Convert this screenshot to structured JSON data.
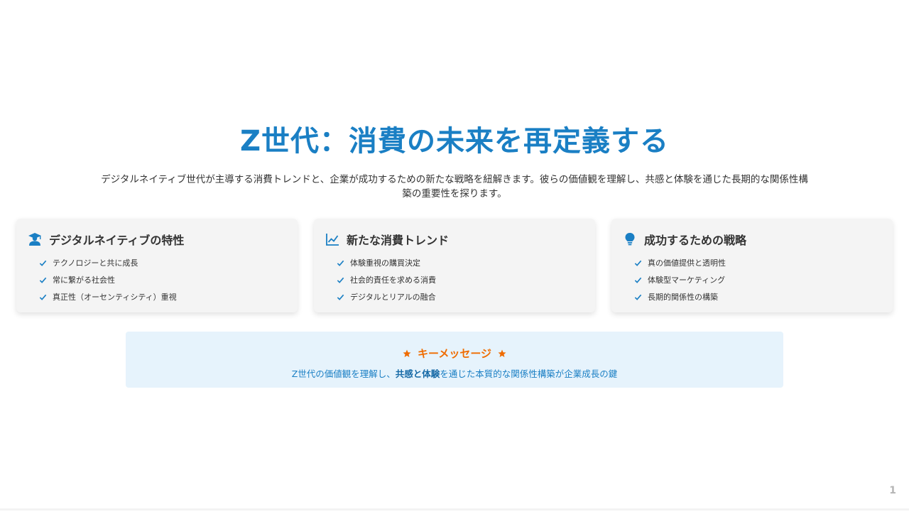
{
  "title": "Z世代：消費の未来を再定義する",
  "subtitle": "デジタルネイティブ世代が主導する消費トレンドと、企業が成功するための新たな戦略を紐解きます。彼らの価値観を理解し、共感と体験を通じた長期的な関係性構築の重要性を探ります。",
  "cards": [
    {
      "icon": "graduate-icon",
      "title": "デジタルネイティブの特性",
      "items": [
        "テクノロジーと共に成長",
        "常に繋がる社会性",
        "真正性（オーセンティシティ）重視"
      ]
    },
    {
      "icon": "line-chart-icon",
      "title": "新たな消費トレンド",
      "items": [
        "体験重視の購買決定",
        "社会的責任を求める消費",
        "デジタルとリアルの融合"
      ]
    },
    {
      "icon": "lightbulb-icon",
      "title": "成功するための戦略",
      "items": [
        "真の価値提供と透明性",
        "体験型マーケティング",
        "長期的関係性の構築"
      ]
    }
  ],
  "key_message": {
    "heading": "キーメッセージ",
    "text_before": "Z世代の価値観を理解し、",
    "text_bold": "共感と体験",
    "text_after": "を通じた本質的な関係性構築が企業成長の鍵"
  },
  "page_number": "1",
  "colors": {
    "accent": "#1a7fc4",
    "highlight": "#ef6c00",
    "card_bg": "#f4f4f4",
    "key_bg": "#e6f3fc"
  }
}
